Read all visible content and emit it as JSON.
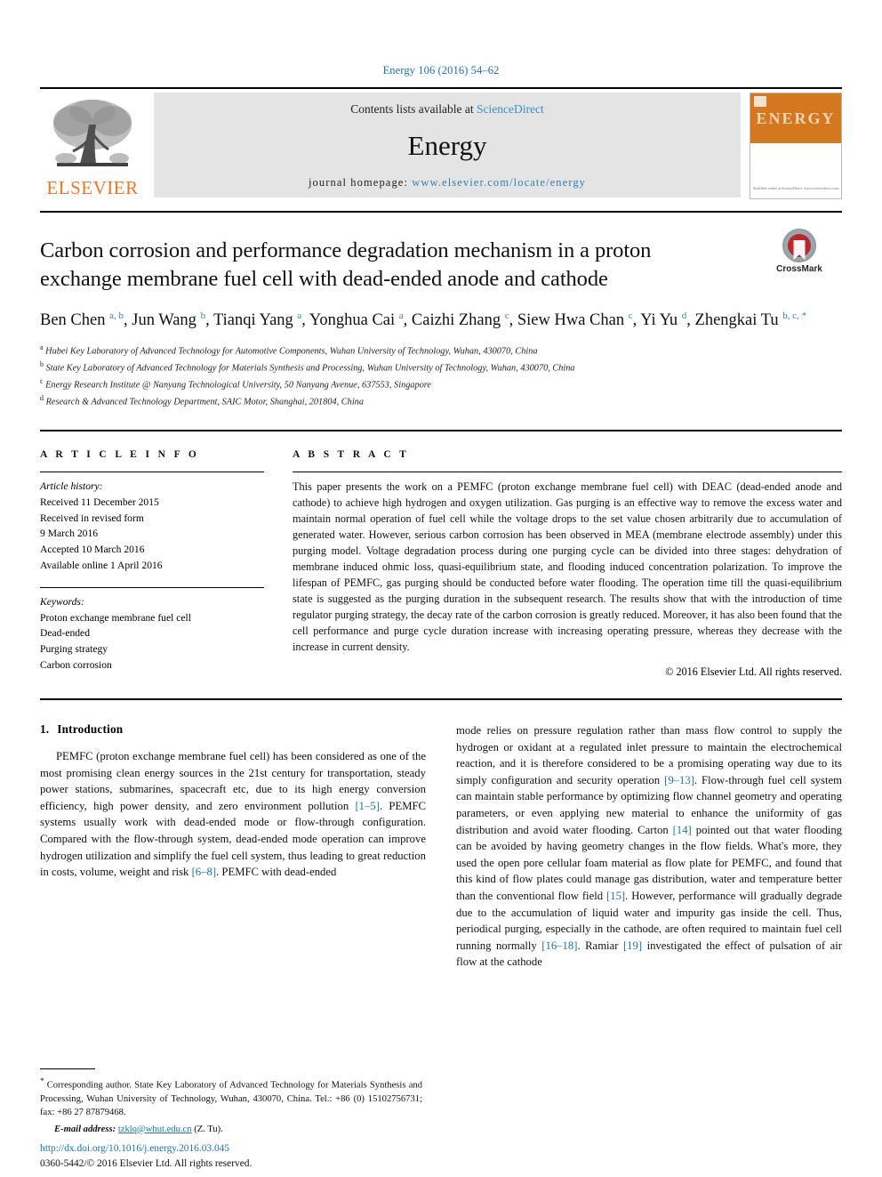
{
  "running_head": "Energy 106 (2016) 54–62",
  "masthead": {
    "publisher_logo_text": "ELSEVIER",
    "contents_prefix": "Contents lists available at ",
    "contents_link": "ScienceDirect",
    "journal_name": "Energy",
    "homepage_label": "journal homepage: ",
    "homepage_url": "www.elsevier.com/locate/energy",
    "cover_title": "ENERGY",
    "cover_footer": "Available online at\nScienceDirect\nwww.sciencedirect.com"
  },
  "article": {
    "title": "Carbon corrosion and performance degradation mechanism in a proton exchange membrane fuel cell with dead-ended anode and cathode",
    "crossmark_label": "CrossMark",
    "authors_html": "Ben Chen <sup>a, b</sup>, Jun Wang <sup>b</sup>, Tianqi Yang <sup>a</sup>, Yonghua Cai <sup>a</sup>, Caizhi Zhang <sup>c</sup>, Siew Hwa Chan <sup>c</sup>, Yi Yu <sup>d</sup>, Zhengkai Tu <sup>b, c, *</sup>",
    "affiliations": [
      {
        "mark": "a",
        "text": "Hubei Key Laboratory of Advanced Technology for Automotive Components, Wuhan University of Technology, Wuhan, 430070, China"
      },
      {
        "mark": "b",
        "text": "State Key Laboratory of Advanced Technology for Materials Synthesis and Processing, Wuhan University of Technology, Wuhan, 430070, China"
      },
      {
        "mark": "c",
        "text": "Energy Research Institute @ Nanyang Technological University, 50 Nanyang Avenue, 637553, Singapore"
      },
      {
        "mark": "d",
        "text": "Research & Advanced Technology Department, SAIC Motor, Shanghai, 201804, China"
      }
    ]
  },
  "info": {
    "heading": "A R T I C L E   I N F O",
    "history_label": "Article history:",
    "history_lines": [
      "Received 11 December 2015",
      "Received in revised form",
      "9 March 2016",
      "Accepted 10 March 2016",
      "Available online 1 April 2016"
    ],
    "keywords_label": "Keywords:",
    "keywords": [
      "Proton exchange membrane fuel cell",
      "Dead-ended",
      "Purging strategy",
      "Carbon corrosion"
    ]
  },
  "abstract": {
    "heading": "A B S T R A C T",
    "text": "This paper presents the work on a PEMFC (proton exchange membrane fuel cell) with DEAC (dead-ended anode and cathode) to achieve high hydrogen and oxygen utilization. Gas purging is an effective way to remove the excess water and maintain normal operation of fuel cell while the voltage drops to the set value chosen arbitrarily due to accumulation of generated water. However, serious carbon corrosion has been observed in MEA (membrane electrode assembly) under this purging model. Voltage degradation process during one purging cycle can be divided into three stages: dehydration of membrane induced ohmic loss, quasi-equilibrium state, and flooding induced concentration polarization. To improve the lifespan of PEMFC, gas purging should be conducted before water flooding. The operation time till the quasi-equilibrium state is suggested as the purging duration in the subsequent research. The results show that with the introduction of time regulator purging strategy, the decay rate of the carbon corrosion is greatly reduced. Moreover, it has also been found that the cell performance and purge cycle duration increase with increasing operating pressure, whereas they decrease with the increase in current density.",
    "copyright": "© 2016 Elsevier Ltd. All rights reserved."
  },
  "body": {
    "section_number": "1.",
    "section_title": "Introduction",
    "left_paragraph_html": "PEMFC (proton exchange membrane fuel cell) has been considered as one of the most promising clean energy sources in the 21st century for transportation, steady power stations, submarines, spacecraft etc, due to its high energy conversion efficiency, high power density, and zero environment pollution <span class=\"ref\">[1–5]</span>. PEMFC systems usually work with dead-ended mode or flow-through configuration. Compared with the flow-through system, dead-ended mode operation can improve hydrogen utilization and simplify the fuel cell system, thus leading to great reduction in costs, volume, weight and risk <span class=\"ref\">[6–8]</span>. PEMFC with dead-ended",
    "right_paragraph_html": "mode relies on pressure regulation rather than mass flow control to supply the hydrogen or oxidant at a regulated inlet pressure to maintain the electrochemical reaction, and it is therefore considered to be a promising operating way due to its simply configuration and security operation <span class=\"ref\">[9–13]</span>. Flow-through fuel cell system can maintain stable performance by optimizing flow channel geometry and operating parameters, or even applying new material to enhance the uniformity of gas distribution and avoid water flooding. Carton <span class=\"ref\">[14]</span> pointed out that water flooding can be avoided by having geometry changes in the flow fields. What's more, they used the open pore cellular foam material as flow plate for PEMFC, and found that this kind of flow plates could manage gas distribution, water and temperature better than the conventional flow field <span class=\"ref\">[15]</span>. However, performance will gradually degrade due to the accumulation of liquid water and impurity gas inside the cell. Thus, periodical purging, especially in the cathode, are often required to maintain fuel cell running normally <span class=\"ref\">[16–18]</span>. Ramiar <span class=\"ref\">[19]</span> investigated the effect of pulsation of air flow at the cathode"
  },
  "footnote": {
    "corresponding_html": "<span class=\"star\">*</span> Corresponding author. State Key Laboratory of Advanced Technology for Materials Synthesis and Processing, Wuhan University of Technology, Wuhan, 430070, China. Tel.: +86 (0) 15102756731; fax: +86 27 87879468.",
    "email_label": "E-mail address:",
    "email": "tzklq@whut.edu.cn",
    "email_suffix": "(Z. Tu)."
  },
  "doi_block": {
    "doi_url": "http://dx.doi.org/10.1016/j.energy.2016.03.045",
    "issn_line": "0360-5442/© 2016 Elsevier Ltd. All rights reserved."
  },
  "colors": {
    "link": "#1a75a8",
    "elsevier_orange": "#ec7623",
    "band_gray": "#e4e4e4",
    "crossmark_red": "#b9262c"
  }
}
